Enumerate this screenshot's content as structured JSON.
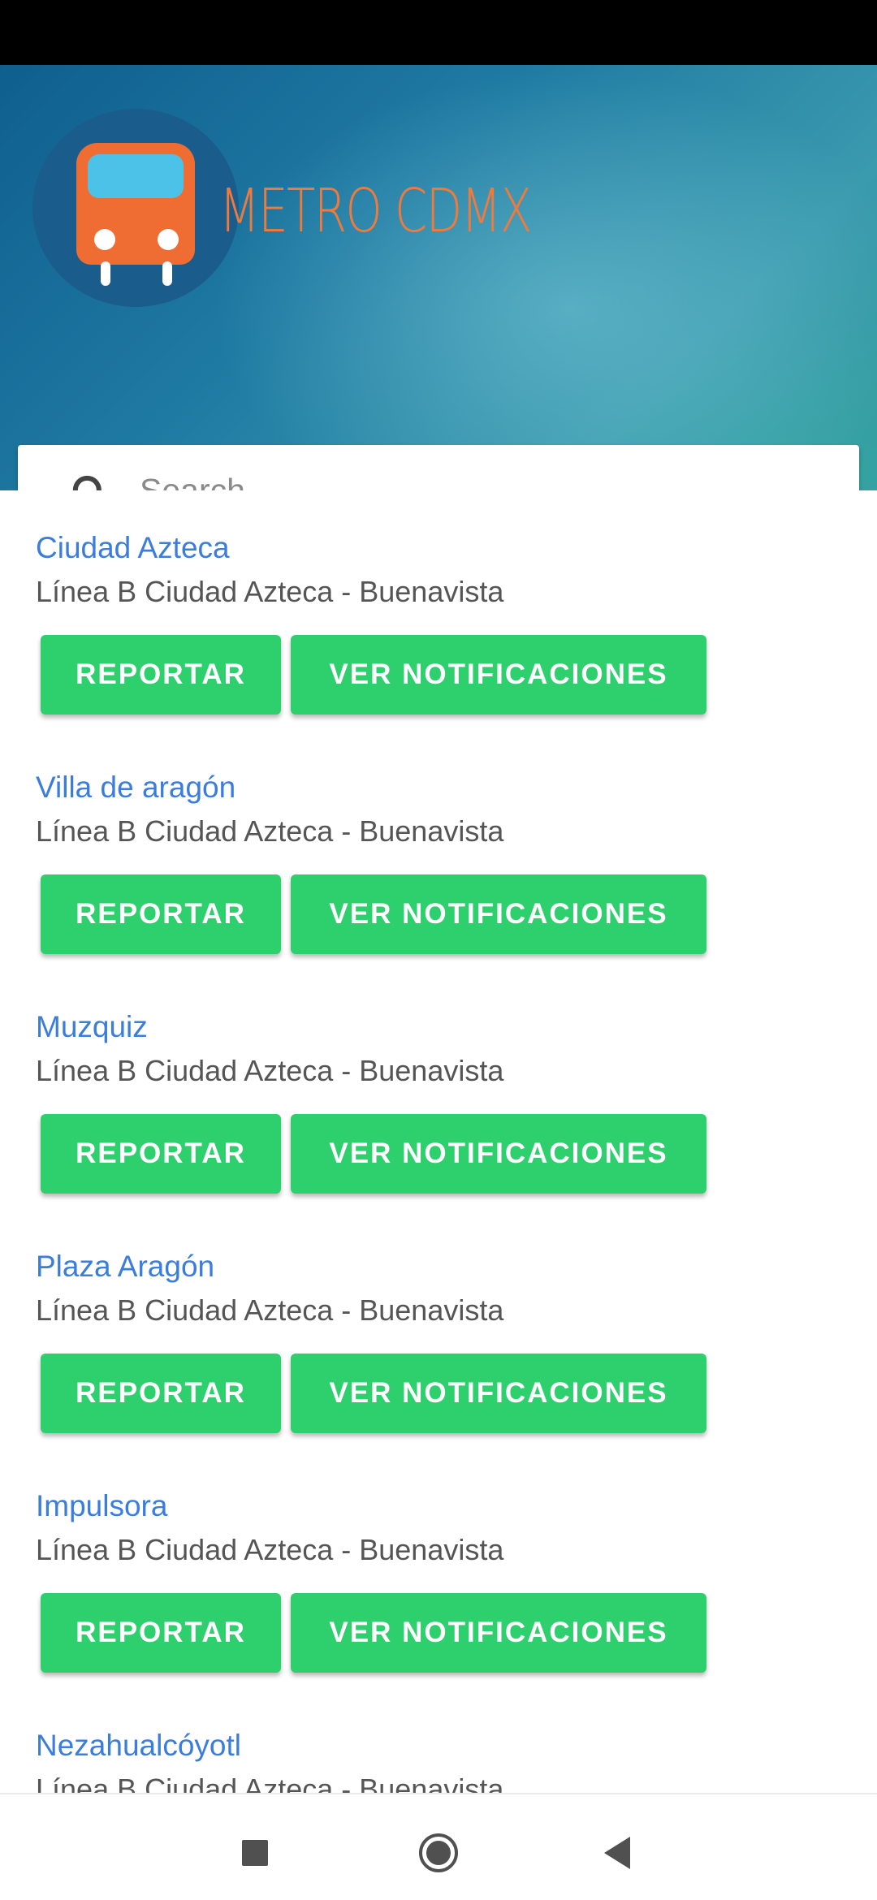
{
  "app": {
    "brand_text": "METRO CDMX",
    "logo_icon": "bus-icon"
  },
  "search": {
    "placeholder": "Search",
    "value": "",
    "icon": "search-icon"
  },
  "buttons": {
    "report_label": "REPORTAR",
    "notifications_label": "VER NOTIFICACIONES"
  },
  "stations": [
    {
      "name": "Ciudad Azteca",
      "line": "Línea B Ciudad Azteca - Buenavista"
    },
    {
      "name": "Villa de aragón",
      "line": "Línea B Ciudad Azteca - Buenavista"
    },
    {
      "name": "Muzquiz",
      "line": "Línea B Ciudad Azteca - Buenavista"
    },
    {
      "name": "Plaza Aragón",
      "line": "Línea B Ciudad Azteca - Buenavista"
    },
    {
      "name": "Impulsora",
      "line": "Línea B Ciudad Azteca - Buenavista"
    },
    {
      "name": "Nezahualcóyotl",
      "line": "Línea B Ciudad Azteca - Buenavista"
    }
  ],
  "nav": {
    "recents_icon": "square-icon",
    "home_icon": "home-circle-icon",
    "back_icon": "back-triangle-icon"
  },
  "colors": {
    "accent_green": "#2ed06e",
    "link_blue": "#3b7ddd",
    "brand_orange": "#f07a3c",
    "header_blue": "#1f7aa3"
  }
}
